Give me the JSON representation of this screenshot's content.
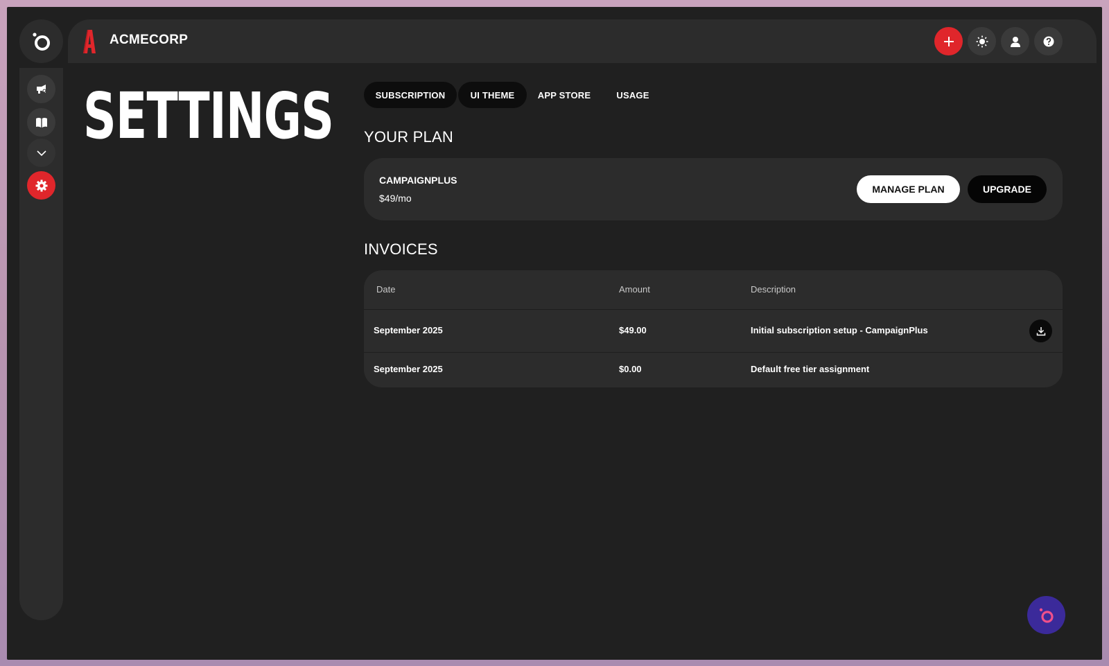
{
  "app": {
    "brand_name": "ACMECORP",
    "brand_letter": "A"
  },
  "page": {
    "title": "SETTINGS"
  },
  "tabs": [
    {
      "label": "SUBSCRIPTION"
    },
    {
      "label": "UI THEME"
    },
    {
      "label": "APP STORE"
    },
    {
      "label": "USAGE"
    }
  ],
  "plan": {
    "heading": "YOUR PLAN",
    "name": "CAMPAIGNPLUS",
    "price": "$49/mo",
    "manage_label": "MANAGE PLAN",
    "upgrade_label": "UPGRADE"
  },
  "invoices": {
    "heading": "INVOICES",
    "columns": [
      "Date",
      "Amount",
      "Description"
    ],
    "rows": [
      {
        "date": "September 2025",
        "amount": "$49.00",
        "description": "Initial subscription setup - CampaignPlus"
      },
      {
        "date": "September 2025",
        "amount": "$0.00",
        "description": "Default free tier assignment"
      }
    ]
  },
  "icons": {
    "logo": "ring-logo-icon",
    "campaigns": "megaphone-icon",
    "library": "book-icon",
    "expand": "chevron-down-icon",
    "settings": "gear-icon",
    "add": "plus-icon",
    "theme": "sun-icon",
    "profile": "user-icon",
    "help": "help-icon",
    "download": "download-icon",
    "assistant": "assistant-icon"
  },
  "colors": {
    "accent": "#e0262b",
    "background": "#202020",
    "panel": "#2c2c2c",
    "assistant": "#3b2a9a"
  }
}
